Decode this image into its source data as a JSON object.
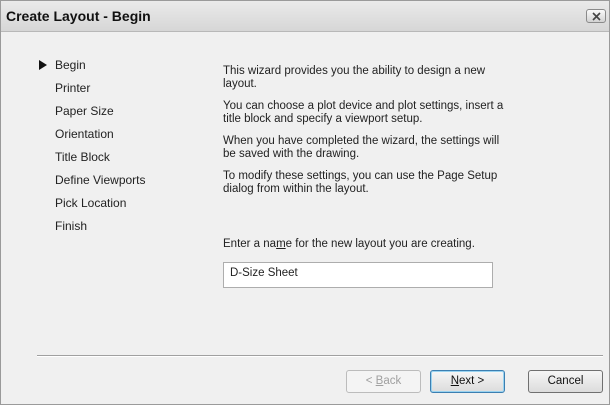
{
  "window": {
    "title": "Create Layout - Begin"
  },
  "steps": [
    {
      "label": "Begin",
      "current": true
    },
    {
      "label": "Printer"
    },
    {
      "label": "Paper Size"
    },
    {
      "label": "Orientation"
    },
    {
      "label": "Title Block"
    },
    {
      "label": "Define Viewports"
    },
    {
      "label": "Pick Location"
    },
    {
      "label": "Finish"
    }
  ],
  "content": {
    "paragraphs": [
      "This wizard provides you the ability to design a new layout.",
      "You can choose a plot device and plot settings, insert a title block and specify a viewport setup.",
      "When you have completed the wizard, the settings will be saved with the drawing.",
      "To modify these settings, you can use the Page Setup dialog from within the layout."
    ],
    "prompt": {
      "before": "Enter a na",
      "accel": "m",
      "after": "e for the new layout you are creating."
    },
    "layout_name": "D-Size Sheet"
  },
  "buttons": {
    "back": {
      "before": "< ",
      "accel": "B",
      "after": "ack"
    },
    "next": {
      "before": "",
      "accel": "N",
      "after": "ext >"
    },
    "cancel": "Cancel"
  }
}
